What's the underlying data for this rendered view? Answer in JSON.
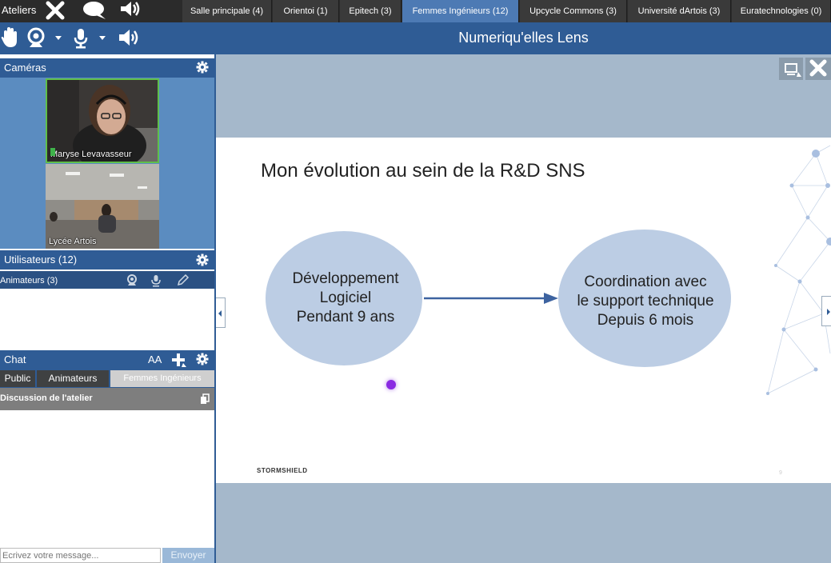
{
  "app": {
    "section_title": "Ateliers"
  },
  "rooms": [
    {
      "label": "Salle principale (4)",
      "active": false
    },
    {
      "label": "Orientoi (1)",
      "active": false
    },
    {
      "label": "Epitech (3)",
      "active": false
    },
    {
      "label": "Femmes Ingénieurs (12)",
      "active": true
    },
    {
      "label": "Upcycle Commons (3)",
      "active": false
    },
    {
      "label": "Université dArtois (3)",
      "active": false
    },
    {
      "label": "Euratechnologies (0)",
      "active": false
    }
  ],
  "session": {
    "title": "Numeriqu'elles Lens"
  },
  "cameras": {
    "header": "Caméras",
    "feeds": [
      {
        "label": "Maryse Levavasseur"
      },
      {
        "label": "Lycée Artois"
      }
    ]
  },
  "users": {
    "header": "Utilisateurs (12)",
    "group": "Animateurs (3)"
  },
  "chat": {
    "header": "Chat",
    "font_button": "AA",
    "tabs": [
      {
        "label": "Public"
      },
      {
        "label": "Animateurs"
      },
      {
        "label": "Femmes Ingénieurs",
        "active": true
      }
    ],
    "thread_title": "Discussion de l'atelier",
    "input_placeholder": "Ecrivez votre message...",
    "send_label": "Envoyer"
  },
  "slide": {
    "title": "Mon évolution au sein de la R&D SNS",
    "left_bubble": [
      "Développement",
      "Logiciel",
      "Pendant 9 ans"
    ],
    "right_bubble": [
      "Coordination avec",
      "le support technique",
      "Depuis 6 mois"
    ],
    "footer_brand": "STORMSHIELD",
    "page_number": "9"
  },
  "colors": {
    "topbar": "#2b2b2b",
    "toolbar": "#2f5c95",
    "active_tab": "#4d7ab4",
    "bubble": "#bccde4",
    "arrow": "#3d63a0",
    "main_bg": "#a5b8cb"
  },
  "icons": [
    "x-icon",
    "speech-bubble-icon",
    "broadcast-icon",
    "hand-raise-icon",
    "webcam-icon",
    "microphone-icon",
    "speaker-icon",
    "gear-icon",
    "text-size-icon",
    "plus-icon",
    "pencil-icon",
    "copy-icon",
    "presentation-icon",
    "close-icon",
    "pointer-dot-icon"
  ]
}
